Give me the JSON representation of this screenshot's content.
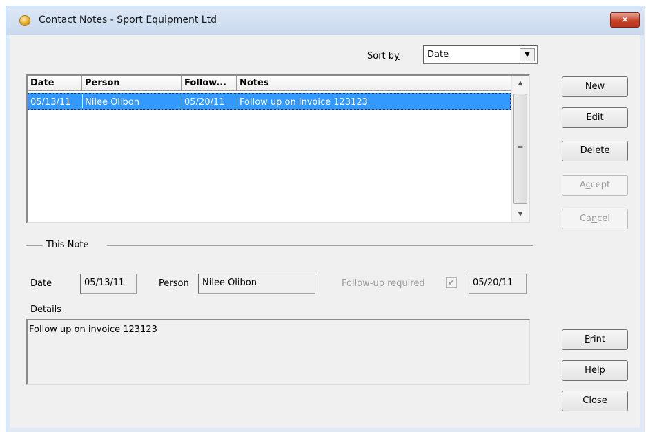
{
  "window": {
    "title": "Contact Notes - Sport Equipment Ltd",
    "close_glyph": "✕"
  },
  "sort": {
    "label_pre": "Sort b",
    "label_key": "y",
    "value": "Date"
  },
  "list": {
    "columns": [
      "Date",
      "Person",
      "Follow...",
      "Notes"
    ],
    "rows": [
      {
        "date": "05/13/11",
        "person": "Nilee Olibon",
        "follow": "05/20/11",
        "notes": "Follow up on invoice 123123",
        "selected": true
      }
    ]
  },
  "note": {
    "group_label": "This Note",
    "date_label_key": "D",
    "date_label_rest": "ate",
    "date_value": "05/13/11",
    "person_label_pre": "Pe",
    "person_label_key": "r",
    "person_label_post": "son",
    "person_value": "Nilee Olibon",
    "followup_label_pre": "Follo",
    "followup_label_key": "w",
    "followup_label_post": "-up required",
    "followup_checked": true,
    "followup_date": "05/20/11",
    "details_label_pre": "Detail",
    "details_label_key": "s",
    "details_value": "Follow up on invoice 123123"
  },
  "buttons": {
    "new": {
      "key": "N",
      "rest": "ew",
      "enabled": true
    },
    "edit": {
      "key": "E",
      "rest": "dit",
      "enabled": true
    },
    "delete": {
      "pre": "De",
      "key": "l",
      "post": "ete",
      "enabled": true
    },
    "accept": {
      "pre": "A",
      "key": "c",
      "post": "cept",
      "enabled": false
    },
    "cancel": {
      "pre": "Ca",
      "key": "n",
      "post": "cel",
      "enabled": false
    },
    "print": {
      "key": "P",
      "rest": "rint",
      "enabled": true
    },
    "help": {
      "label": "Help",
      "enabled": true
    },
    "close": {
      "label": "Close",
      "enabled": true
    }
  },
  "colors": {
    "selection": "#3399ff",
    "title_close": "#c7442a",
    "window_bg": "#f0f0f0"
  },
  "icons": {
    "app": "app-icon",
    "dropdown": "chevron-down-icon",
    "scroll_up": "scroll-up-icon",
    "scroll_down": "scroll-down-icon",
    "check": "checkmark-icon"
  }
}
